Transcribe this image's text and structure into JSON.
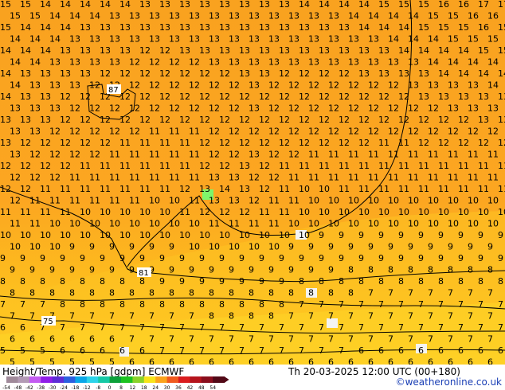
{
  "header": {
    "title": "Height/Temp. 925 hPa [gdpm] ECMWF",
    "datetime": "Th 20-03-2025 12:00 UTC (00+180)",
    "credit": "©weatheronline.co.uk"
  },
  "map": {
    "contour_labels": [
      "87",
      "81",
      "75"
    ],
    "temperature_rows": [
      "15 15 14 14 14 14 14 13 13 13 13 13 13 13 13 14 14 14 14 15 15 15 16 16 17 17",
      "15 15 14 14 14 13 13 13 13 13 13 13 13 13 13 13 13 14 14 14 14 15 15 16 16 16",
      "15 14 14 14 13 13 13 13 13 13 13 13 13 13 13 13 13 13 14 14 14 15 15 15 16 15",
      "14 14 14 13 13 13 13 13 13 13 13 13 13 13 13 13 13 13 13 14 14 14 15 15 15 15",
      "14 14 14 13 13 13 13 12 12 13 13 13 13 13 13 13 13 13 13 13 14 14 14 14 15 15",
      "14 14 13 13 13 13 12 12 12 12 13 13 13 13 13 13 13 13 13 13 13 14 14 14 14 14",
      "14 13 13 13 13 12 12 12 12 12 12 12 13 13 12 12 12 12 13 13 13 13 14 14 14 14",
      "14 13 13 13 12 12 12 12 12 12 12 12 13 12 12 12 12 12 12 12 13 13 13 13 14 14",
      "14 13 13 12 12 12 12 12 12 12 12 12 12 12 12 12 12 12 12 12 12 13 13 13 13 13",
      "13 13 13 12 12 12 12 12 12 12 12 12 13 12 12 12 12 12 12 12 12 12 13 13 13 13",
      "13 13 13 12 12 12 12 12 12 12 12 12 12 12 12 12 12 12 12 12 12 12 12 12 13 13",
      "13 13 12 12 12 12 12 11 11 11 12 12 12 12 12 12 12 12 12 12 12 12 12 12 12 13",
      "13 12 12 12 12 12 11 11 11 11 12 12 12 12 12 12 12 12 12 11 11 12 12 12 12 12",
      "13 12 12 12 12 11 11 11 11 11 12 12 13 12 12 11 11 11 11 11 11 11 11 11 11 11",
      "12 12 12 12 11 11 11 11 11 11 12 12 13 12 11 11 11 11 11 11 11 11 11 11 11 11",
      "12 12 12 11 11 11 11 11 11 11 13 13 12 12 11 11 11 11 11 11 11 11 11 11 11 11",
      "12 12 11 11 11 11 11 11 11 12 13 14 13 12 11 10 10 11 11 11 11 11 11 11 11 11",
      "12 11 11 11 11 11 11 10 10 11 13 13 12 11 11 10 10 10 10 10 10 10 10 10 10 10",
      "11 11 11 11 10 10 10 10 10 11 12 12 12 11 11 10 10 10 10 10 10 10 10 10 10 10",
      "11 11 10 10 10 10 10 10 10 10 11 11 11 11 10 10 10 10 10 10 10 10 10 10 10 10",
      "10 10 10 10 10 10 10 10 10 10 10 10 10 10 10 10 9 9 9 9 9 9 9 9 9 9",
      "10 10 10 9 9 9 9 9 9 10 10 10 10 10 9 9 9 9 9 9 9 9 9 9 9 9",
      "9 9 9 9 9 9 9 9 9 9 9 9 9 9 9 9 9 9 9 9 9 9 9 9 9 9",
      "9 9 9 9 9 9 9 9 9 9 9 9 9 9 9 9 9 8 8 8 8 8 8 8 8 8",
      "8 8 8 8 8 8 8 8 9 9 9 9 9 9 9 8 8 8 8 8 8 8 8 8 8 8",
      "8 8 8 8 8 8 8 8 8 8 8 8 8 8 8 8 8 8 7 7 7 7 7 7 7 7",
      "7 7 7 8 8 8 8 8 8 8 8 8 8 8 8 7 7 7 7 7 7 7 7 7 7 7",
      "7 7 7 7 7 7 7 7 7 7 8 8 8 8 7 7 7 7 7 7 7 7 7 7 7 7",
      "6 6 7 7 7 7 7 7 7 7 7 7 7 7 7 7 7 7 7 7 7 7 7 7 7 7",
      "6 6 6 6 6 6 7 7 7 7 7 7 7 7 7 7 7 7 7 7 7 7 7 7 7 7",
      "5 5 5 6 6 6 6 6 7 7 7 7 7 7 7 7 7 7 6 6 6 6 6 6 6 6",
      "5 5 5 5 5 5 6 6 6 6 6 6 6 6 6 6 6 6 6 6 6 6 6 6 6 6"
    ],
    "colors": {
      "warm": "#f8a21e",
      "mid": "#fdb71f",
      "cool": "#ffd529",
      "green_pixel": "#7ef66b",
      "white_pixel": "#f4f4f4"
    }
  },
  "legend": {
    "ticks": [
      "-54",
      "-48",
      "-42",
      "-38",
      "-30",
      "-24",
      "-18",
      "-12",
      "-8",
      "0",
      "8",
      "12",
      "18",
      "24",
      "30",
      "36",
      "42",
      "48",
      "54"
    ],
    "colors": [
      "#a08a9a",
      "#b39bb5",
      "#c35bf1",
      "#8f1de8",
      "#5e2dd6",
      "#2b5fe0",
      "#0aa7e8",
      "#2cd3ea",
      "#16c9a6",
      "#0ca13a",
      "#1cc321",
      "#8ad22a",
      "#f7e41a",
      "#fba41c",
      "#f05a1f",
      "#da1d1f",
      "#b5141c",
      "#8a0e1d",
      "#520917"
    ]
  }
}
